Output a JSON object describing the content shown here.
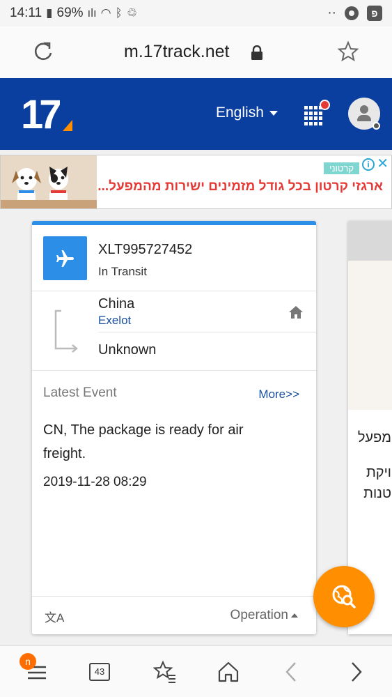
{
  "status_bar": {
    "time": "14:11",
    "battery": "69%",
    "dots": "··"
  },
  "browser": {
    "url": "m.17track.net",
    "tab_count": "43",
    "menu_badge": "n"
  },
  "header": {
    "logo_text": "17",
    "language": "English"
  },
  "ad": {
    "tag": "קרטוני",
    "text": "ארגזי קרטון בכל גודל מזמינים ישירות מהמפעל...",
    "info": "i",
    "close": "✕"
  },
  "tracking": {
    "number": "XLT995727452",
    "status": "In Transit",
    "origin": "China",
    "carrier": "Exelot",
    "destination": "Unknown",
    "latest_event_label": "Latest Event",
    "more_label": "More>>",
    "event_description": "CN, The package is ready for air freight.",
    "event_time": "2019-11-28 08:29",
    "operation_label": "Operation",
    "translate_glyph": "文A"
  },
  "peek_card": {
    "line1": "מפעל",
    "line2": "ויקת",
    "line3": "טנות"
  },
  "colors": {
    "brand_blue": "#0a3fa0",
    "accent_blue": "#2c8ee6",
    "link_blue": "#1a4fa0",
    "fab_orange": "#ff8f00",
    "logo_orange": "#ff8f00"
  },
  "icons": {
    "reload": "reload-icon",
    "lock": "lock-icon",
    "bookmark": "star-icon",
    "apps": "apps-grid-icon",
    "profile": "avatar-icon",
    "transport": "airplane-icon",
    "home": "home-icon",
    "translate": "translate-icon",
    "fab": "globe-search-icon"
  }
}
